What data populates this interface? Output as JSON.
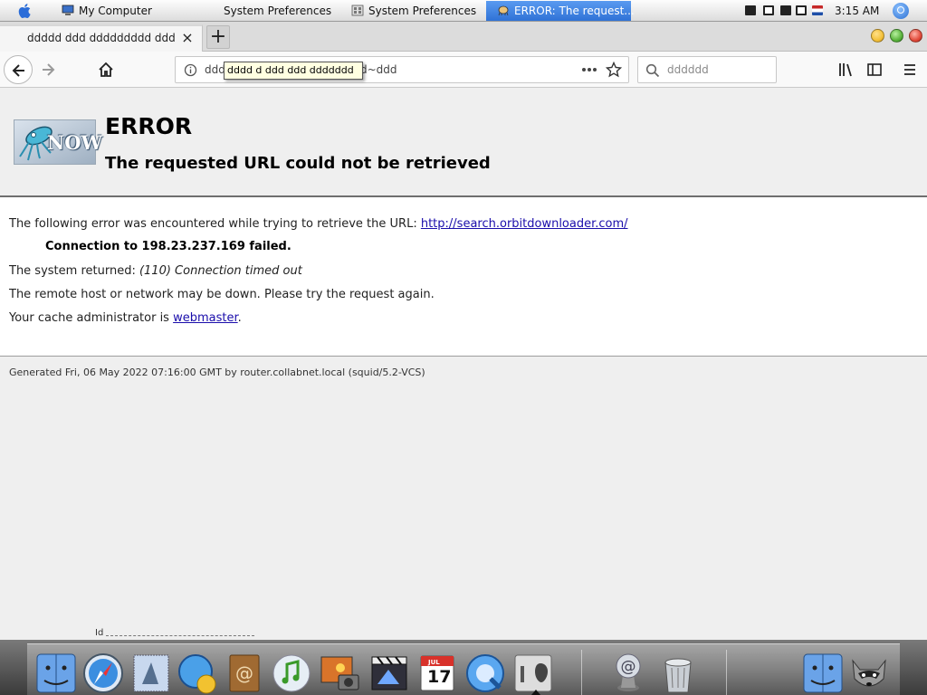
{
  "menubar": {
    "tasks": [
      {
        "label": "My Computer",
        "icon": "computer-icon"
      },
      {
        "label": "System Preferences",
        "icon": "none"
      },
      {
        "label": "System Preferences",
        "icon": "preferences-icon"
      },
      {
        "label": "ERROR: The request...",
        "icon": "squid-icon"
      }
    ],
    "clock": "3:15 AM"
  },
  "browser": {
    "tab_title": "ddddd ddd ddddddddd ddd dd",
    "tab_close": "×",
    "new_tab": "+",
    "url_text": "ddd",
    "url_tail": "d~ddd",
    "url_tooltip": "dddd d ddd ddd ddddddd",
    "search_placeholder": "dddddd"
  },
  "page": {
    "title": "ERROR",
    "subtitle": "The requested URL could not be retrieved",
    "line1_prefix": "The following error was encountered while trying to retrieve the URL:",
    "line1_link": "http://search.orbitdownloader.com/",
    "line2": "Connection to 198.23.237.169 failed.",
    "line3_prefix": "The system returned:",
    "line3_value": "(110) Connection timed out",
    "line4": "The remote host or network may be down. Please try the request again.",
    "line5_prefix": "Your cache administrator is",
    "line5_link": "webmaster",
    "line5_suffix": ".",
    "footer": "Generated Fri, 06 May 2022 07:16:00 GMT by router.collabnet.local (squid/5.2-VCS)",
    "logo_text": "NOW",
    "status_fragment": "Id"
  },
  "dock": {
    "items": [
      "finder-icon",
      "safari-icon",
      "mail-icon",
      "ichat-icon",
      "address-book-icon",
      "itunes-icon",
      "iphoto-icon",
      "imovie-icon",
      "ical-icon",
      "quicktime-icon",
      "system-preferences-icon",
      "mail-server-icon",
      "trash-icon",
      "finder-icon",
      "raccoon-icon"
    ],
    "ical_month": "JUL",
    "ical_day": "17"
  },
  "colors": {
    "link": "#1a0dab",
    "active_task": "#2f72d6",
    "close_button": "#e24b3b",
    "minimize_button": "#f3c13a",
    "zoom_button": "#5bb43d"
  }
}
